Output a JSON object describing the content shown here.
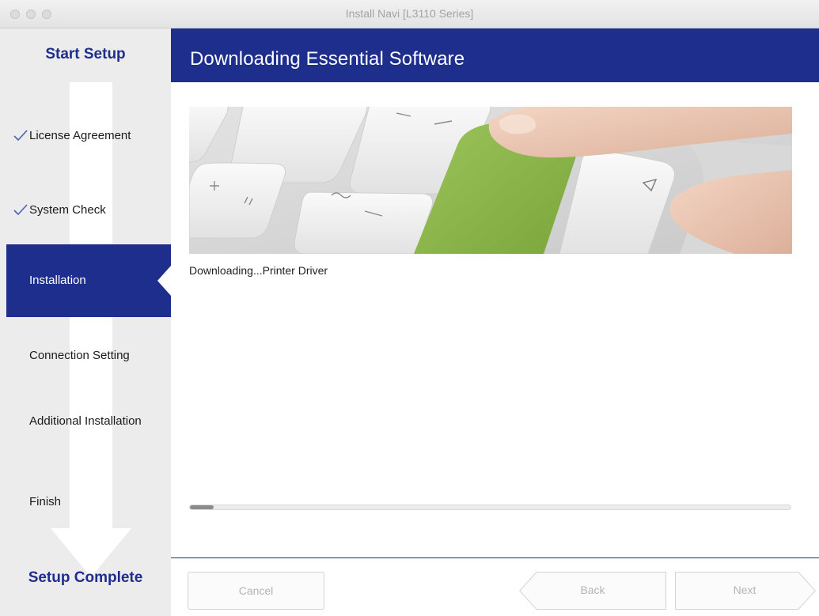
{
  "window": {
    "title": "Install Navi [L3110 Series]"
  },
  "sidebar": {
    "start_label": "Start Setup",
    "complete_label": "Setup Complete",
    "steps": [
      {
        "label": "License Agreement",
        "done": true
      },
      {
        "label": "System Check",
        "done": true
      },
      {
        "label": "Installation",
        "active": true
      },
      {
        "label": "Connection Setting"
      },
      {
        "label": "Additional Installation"
      },
      {
        "label": "Finish"
      }
    ],
    "check_glyph": "✓"
  },
  "main": {
    "heading": "Downloading Essential Software",
    "status_text": "Downloading...Printer Driver",
    "progress": 0.04
  },
  "footer": {
    "cancel_label": "Cancel",
    "back_label": "Back",
    "next_label": "Next"
  },
  "colors": {
    "brand_blue": "#1e2e8c",
    "sidebar_bg": "#ececec",
    "key_green": "#8bb54a"
  }
}
